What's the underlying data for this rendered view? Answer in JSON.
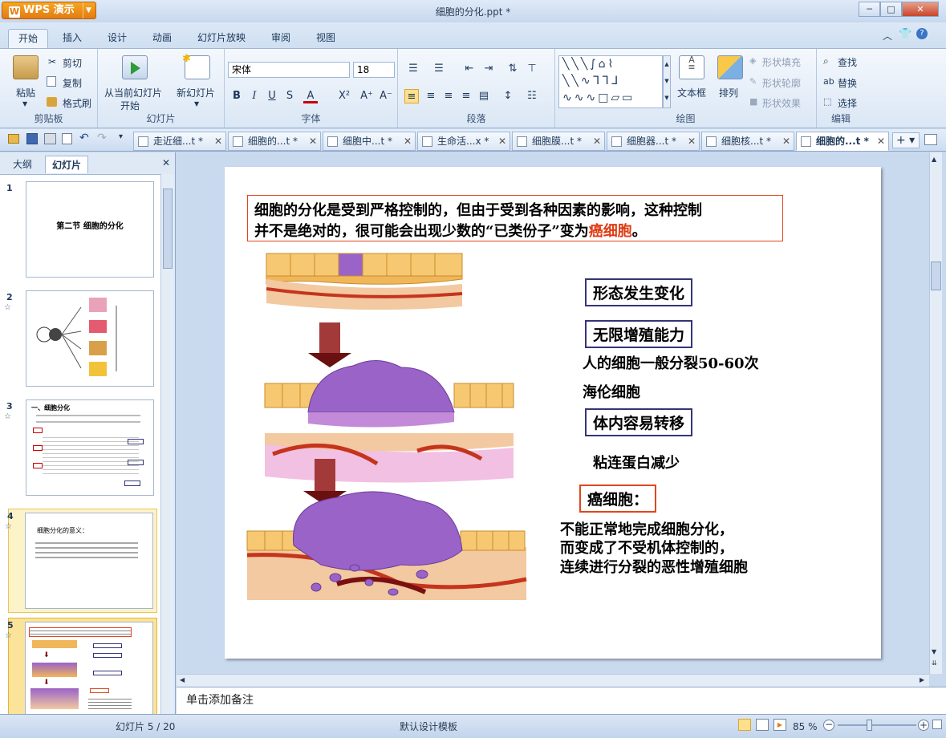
{
  "app": {
    "name": "WPS 演示",
    "doc_title": "细胞的分化.ppt *"
  },
  "window_buttons": [
    "─",
    "□",
    "✕"
  ],
  "ribbon_tabs": [
    "开始",
    "插入",
    "设计",
    "动画",
    "幻灯片放映",
    "审阅",
    "视图"
  ],
  "ribbon": {
    "clipboard": {
      "paste": "粘贴",
      "cut": "剪切",
      "copy": "复制",
      "format_painter": "格式刷",
      "label": "剪贴板"
    },
    "slides": {
      "from_current": "从当前幻灯片",
      "start": "开始",
      "new_slide": "新幻灯片",
      "label": "幻灯片"
    },
    "font": {
      "name": "宋体",
      "size": "18",
      "label": "字体"
    },
    "paragraph": {
      "label": "段落"
    },
    "drawing": {
      "textbox": "文本框",
      "arrange": "排列",
      "shape_fill": "形状填充",
      "shape_outline": "形状轮廓",
      "shape_effect": "形状效果",
      "label": "绘图"
    },
    "edit": {
      "find": "查找",
      "replace": "替换",
      "select": "选择",
      "label": "编辑"
    }
  },
  "doc_tabs": [
    "走近细...t *",
    "细胞的...t *",
    "细胞中...t *",
    "生命活...x *",
    "细胞膜...t *",
    "细胞器...t *",
    "细胞核...t *",
    "细胞的...t *"
  ],
  "panel_tabs": [
    "大纲",
    "幻灯片"
  ],
  "thumbnails": [
    {
      "num": "1",
      "text": "第二节  细胞的分化"
    },
    {
      "num": "2",
      "star": "☆"
    },
    {
      "num": "3",
      "star": "☆",
      "text": "一、细胞分化"
    },
    {
      "num": "4",
      "star": "☆",
      "text": "细胞分化的意义："
    },
    {
      "num": "5",
      "star": "☆"
    }
  ],
  "slide": {
    "intro_line1": "细胞的分化是受到严格控制的，但由于受到各种因素的影响，这种控制",
    "intro_line2_a": "并不是绝对的，很可能会出现少数的“已类份子”变为",
    "intro_line2_b": "癌细胞",
    "intro_line2_c": "。",
    "box1": "形态发生变化",
    "box2": "无限增殖能力",
    "text_division": "人的细胞一般分裂50-60次",
    "text_hela": "海伦细胞",
    "box3": "体内容易转移",
    "text_adhesion": "粘连蛋白减少",
    "box4": "癌细胞：",
    "def_line1": "不能正常地完成细胞分化，",
    "def_line2": "而变成了不受机体控制的，",
    "def_line3": "连续进行分裂的恶性增殖细胞"
  },
  "notes_placeholder": "单击添加备注",
  "status": {
    "slide_counter": "幻灯片 5 / 20",
    "template": "默认设计模板",
    "zoom": "85 %"
  },
  "colors": {
    "accent_orange": "#e47b12",
    "box_border": "#34347a",
    "red_text": "#e03a12",
    "red_box": "#e2461b"
  }
}
